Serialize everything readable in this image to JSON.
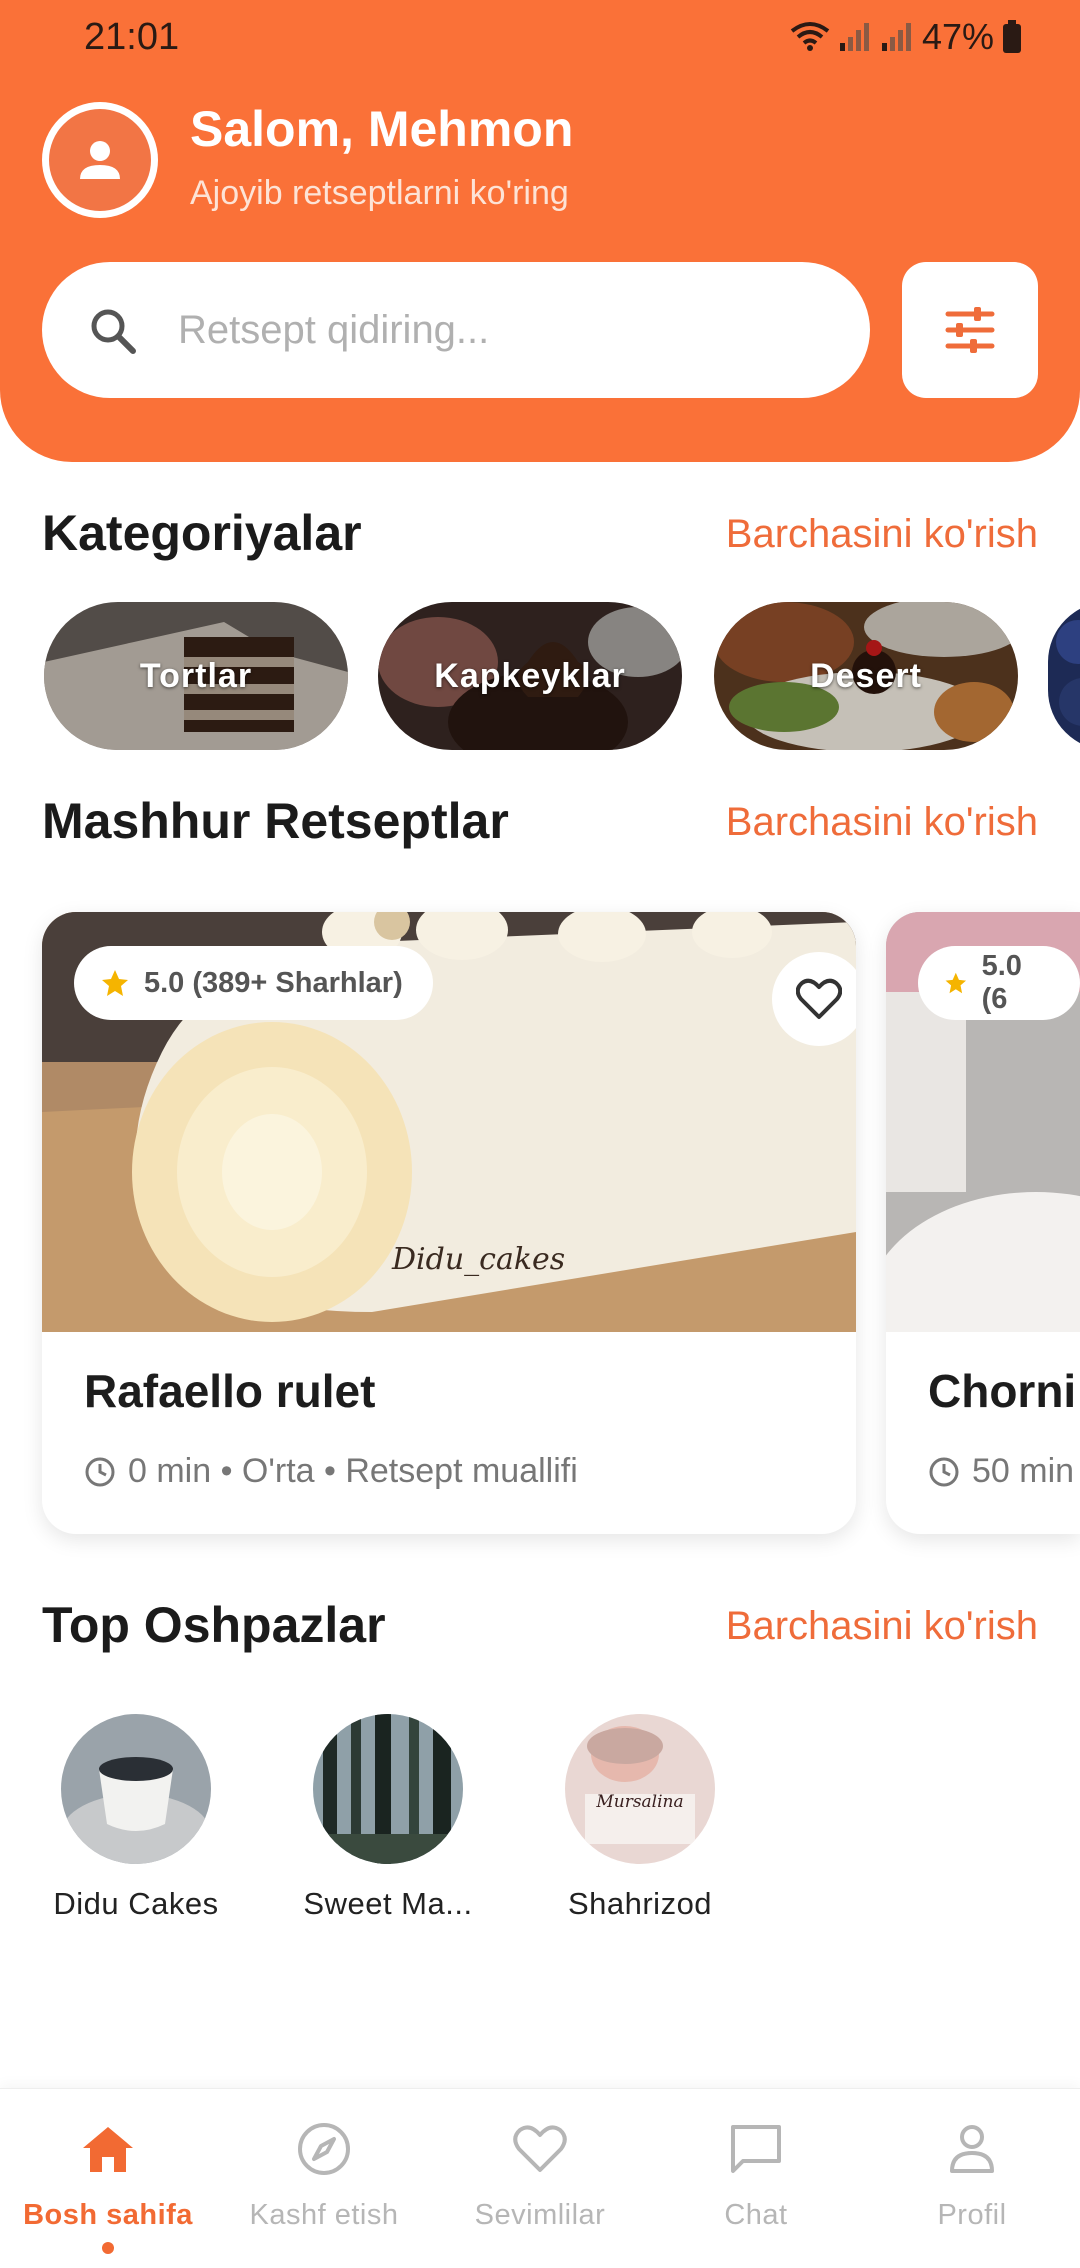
{
  "status_bar": {
    "time": "21:01",
    "battery": "47%"
  },
  "header": {
    "greeting": "Salom, Mehmon",
    "subtitle": "Ajoyib retseptlarni ko'ring",
    "search_placeholder": "Retsept qidiring..."
  },
  "categories": {
    "title": "Kategoriyalar",
    "see_all": "Barchasini ko'rish",
    "items": [
      {
        "label": "Tortlar"
      },
      {
        "label": "Kapkeyklar"
      },
      {
        "label": "Desert"
      }
    ]
  },
  "popular": {
    "title": "Mashhur Retseptlar",
    "see_all": "Barchasini ko'rish",
    "recipes": [
      {
        "rating": "5.0 (389+ Sharhlar)",
        "title": "Rafaello rulet",
        "meta": "0 min • O'rta • Retsept muallifi",
        "watermark": "Didu_cakes"
      },
      {
        "rating": "5.0 (6",
        "title": "Chorni",
        "meta": "50 min"
      }
    ]
  },
  "chefs": {
    "title": "Top Oshpazlar",
    "see_all": "Barchasini ko'rish",
    "items": [
      {
        "name": "Didu Cakes"
      },
      {
        "name": "Sweet Ma..."
      },
      {
        "name": "Shahrizod",
        "avatar_text": "Mursalina"
      }
    ]
  },
  "bottom_nav": {
    "items": [
      {
        "label": "Bosh sahifa",
        "icon": "home-icon",
        "active": true
      },
      {
        "label": "Kashf etish",
        "icon": "compass-icon"
      },
      {
        "label": "Sevimlilar",
        "icon": "heart-icon"
      },
      {
        "label": "Chat",
        "icon": "chat-icon"
      },
      {
        "label": "Profil",
        "icon": "profile-icon"
      }
    ]
  },
  "colors": {
    "accent": "#fa7138",
    "link": "#ef6c3a",
    "star": "#f5b400"
  }
}
